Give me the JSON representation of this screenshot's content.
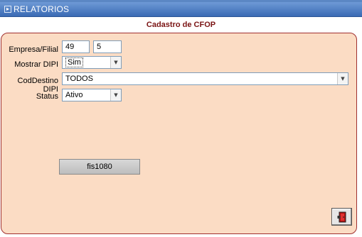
{
  "window": {
    "title": "RELATORIOS",
    "icon": "window-menu-icon"
  },
  "form": {
    "title": "Cadastro de CFOP"
  },
  "fields": {
    "empresa_filial": {
      "label": "Empresa/Filial",
      "empresa": "49",
      "filial": "5"
    },
    "mostrar_dipi": {
      "label": "Mostrar DIPI",
      "value": "Sim"
    },
    "cod_destino_dipi": {
      "label": "CodDestino DIPI",
      "value": "TODOS"
    },
    "status": {
      "label": "Status",
      "value": "Ativo"
    }
  },
  "buttons": {
    "action_label": "fis1080",
    "exit_icon": "exit-door-icon"
  },
  "colors": {
    "titlebar": "#4a7bc4",
    "panel_bg": "#fbdcc4",
    "panel_border": "#a03030",
    "form_title": "#7a1414"
  }
}
